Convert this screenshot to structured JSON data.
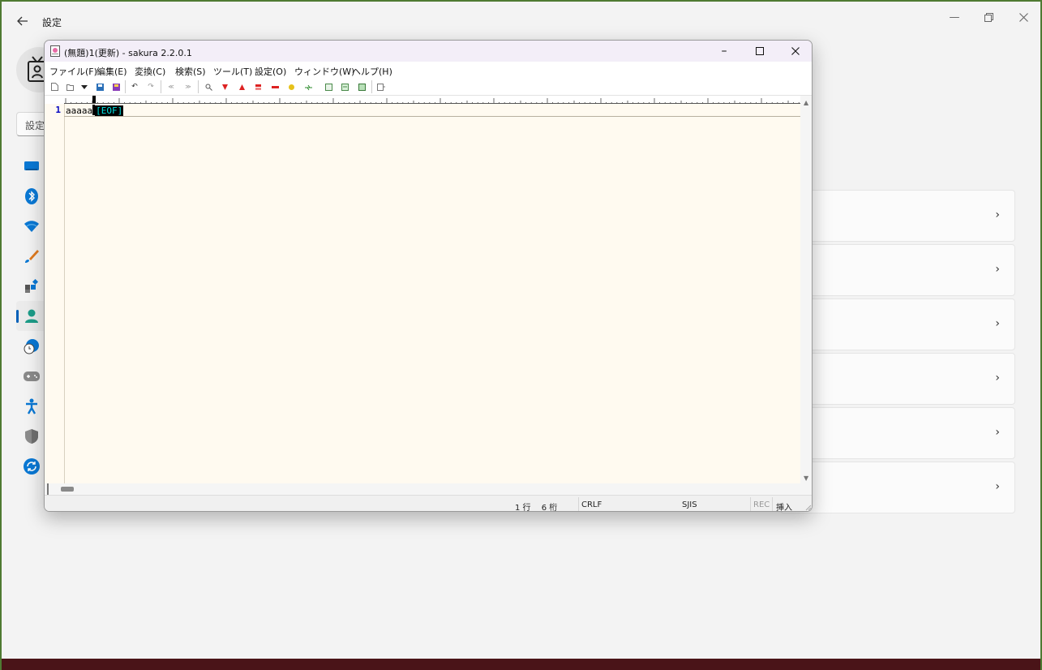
{
  "settings": {
    "title": "設定",
    "back_icon": "arrow-left-icon",
    "search_placeholder": "設定",
    "nav_icons": [
      "system-icon",
      "bluetooth-icon",
      "network-icon",
      "personalization-icon",
      "apps-icon",
      "accounts-icon",
      "time-language-icon",
      "gaming-icon",
      "accessibility-icon",
      "privacy-security-icon",
      "windows-update-icon"
    ],
    "active_nav": "accounts-icon",
    "cards_count": 6
  },
  "editor_window": {
    "title": "(無題)1(更新) - sakura 2.2.0.1",
    "menu": [
      "ファイル(F)",
      "編集(E)",
      "変換(C)",
      "検索(S)",
      "ツール(T)",
      "設定(O)",
      "ウィンドウ(W)",
      "ヘルプ(H)"
    ],
    "line_number": "1",
    "line_text": "aaaaa",
    "eof_marker": "[EOF]",
    "status": {
      "position": "1 行　 6 桁",
      "newline": "CRLF",
      "encoding": "SJIS",
      "rec": "REC",
      "mode": "挿入"
    }
  },
  "colors": {
    "editor_bg": "#fffaf0",
    "line_number": "#0000c0",
    "eof_fg": "#00e0e0",
    "accent": "#005fb8"
  }
}
